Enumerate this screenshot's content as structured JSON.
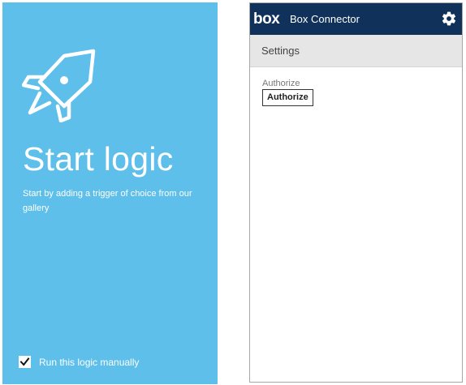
{
  "start_panel": {
    "title": "Start logic",
    "description": "Start by adding a trigger of choice from our gallery",
    "rocket_icon": "rocket-icon",
    "manual_checkbox": {
      "label": "Run this logic manually",
      "checked": true
    },
    "background_color": "#5dbfea"
  },
  "connector": {
    "logo_text": "box",
    "title": "Box Connector",
    "settings_icon": "gear-icon",
    "header_color": "#10325a",
    "settings_label": "Settings",
    "authorize_label": "Authorize",
    "authorize_button": "Authorize"
  }
}
